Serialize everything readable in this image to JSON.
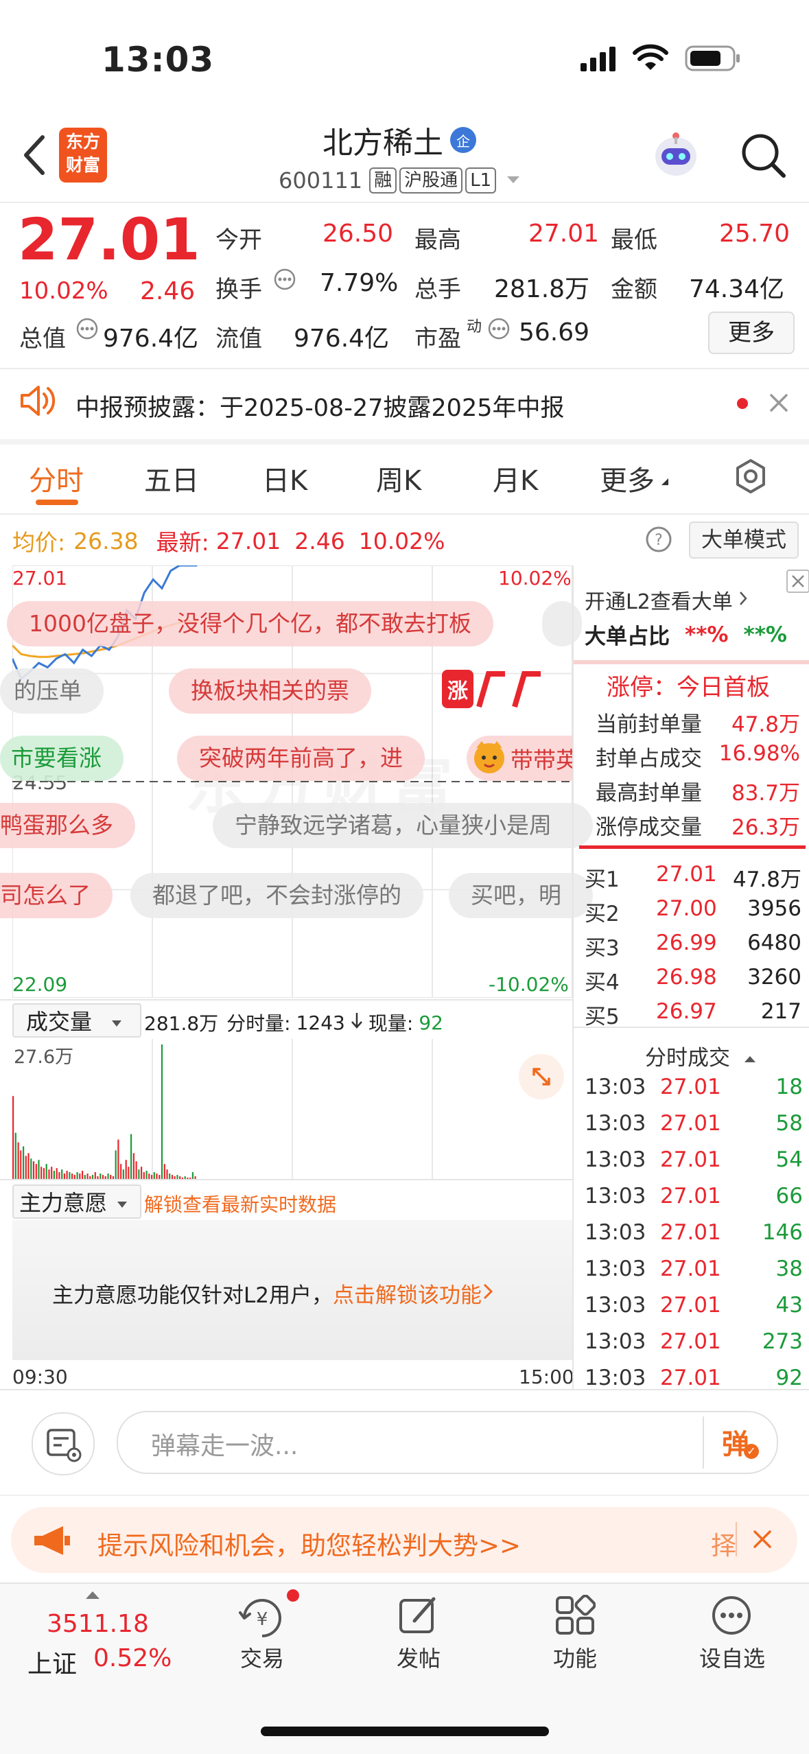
{
  "status_bar": {
    "time": "13:03"
  },
  "header": {
    "logo_line1": "东方",
    "logo_line2": "财富",
    "stock_name": "北方稀土",
    "badge": "企",
    "stock_code": "600111",
    "tags": [
      "融",
      "沪股通",
      "L1"
    ]
  },
  "quote": {
    "price": "27.01",
    "change_pct": "10.02%",
    "change": "2.46",
    "stats": [
      {
        "label": "今开",
        "value": "26.50"
      },
      {
        "label": "最高",
        "value": "27.01"
      },
      {
        "label": "最低",
        "value": "25.70"
      },
      {
        "label": "换手",
        "value": "7.79%"
      },
      {
        "label": "总手",
        "value": "281.8万"
      },
      {
        "label": "金额",
        "value": "74.34亿"
      },
      {
        "label": "总值",
        "value": "976.4亿"
      },
      {
        "label": "流值",
        "value": "976.4亿"
      },
      {
        "label": "市盈",
        "label_sup": "动",
        "value": "56.69"
      }
    ],
    "more_button": "更多"
  },
  "notice": {
    "text": "中报预披露：于2025-08-27披露2025年中报"
  },
  "tabs": [
    "分时",
    "五日",
    "日K",
    "周K",
    "月K",
    "更多"
  ],
  "chart_info": {
    "avg_label": "均价:",
    "avg_value": "26.38",
    "latest_label": "最新:",
    "latest_value": "27.01",
    "latest_change": "2.46",
    "latest_pct": "10.02%",
    "mode_button": "大单模式"
  },
  "chart_data": {
    "type": "line",
    "y_top_label": "27.01",
    "y_bottom_label": "22.09",
    "y_mid_label": "24.55",
    "right_top_label": "10.02%",
    "right_bottom_label": "-10.02%",
    "x_start": "09:30",
    "x_end": "15:00",
    "ylim": [
      22.09,
      27.01
    ],
    "price_series": [
      25.95,
      25.72,
      25.8,
      25.9,
      25.85,
      25.95,
      26.0,
      25.9,
      26.05,
      25.98,
      26.1,
      26.05,
      26.2,
      26.5,
      26.4,
      26.7,
      26.85,
      26.75,
      26.95,
      27.01,
      27.01,
      27.01
    ],
    "avg_series": [
      26.1,
      26.0,
      25.98,
      25.97,
      25.97,
      25.98,
      25.99,
      26.0,
      26.01,
      26.03,
      26.05,
      26.07,
      26.1,
      26.14,
      26.18,
      26.22,
      26.26,
      26.3,
      26.33,
      26.36,
      26.38,
      26.38
    ]
  },
  "volume": {
    "selector": "成交量",
    "total": "281.8万",
    "period_label": "分时量:",
    "period_value": "1243",
    "now_label": "现量:",
    "now_value": "92",
    "max_label": "27.6万",
    "bars": [
      0.62,
      0.35,
      0.28,
      0.22,
      0.25,
      0.18,
      0.2,
      0.16,
      0.14,
      0.12,
      0.15,
      0.1,
      0.09,
      0.12,
      0.08,
      0.1,
      0.07,
      0.09,
      0.06,
      0.08,
      0.05,
      0.07,
      0.06,
      0.05,
      0.04,
      0.06,
      0.05,
      0.07,
      0.04,
      0.05,
      0.03,
      0.04,
      0.06,
      0.03,
      0.05,
      0.04,
      0.03,
      0.05,
      0.04,
      0.03,
      0.22,
      0.3,
      0.12,
      0.08,
      0.15,
      0.1,
      0.34,
      0.2,
      0.14,
      0.08,
      0.1,
      0.06,
      0.07,
      0.05,
      0.04,
      0.06,
      0.05,
      0.04,
      1.0,
      0.12,
      0.08,
      0.05,
      0.04,
      0.03,
      0.04,
      0.03,
      0.02,
      0.03,
      0.02,
      0.02,
      0.06,
      0.03
    ]
  },
  "main_force": {
    "selector": "主力意愿",
    "unlock_link": "解锁查看最新实时数据",
    "message": "主力意愿功能仅针对L2用户，",
    "message_link": "点击解锁该功能"
  },
  "danmaku": [
    {
      "text": "1000亿盘子，没得个几个亿，都不敢去打板",
      "style": "red"
    },
    {
      "text": "的压单",
      "style": "gray"
    },
    {
      "text": "换板块相关的票",
      "style": "red"
    },
    {
      "text": "市要看涨",
      "style": "green"
    },
    {
      "text": "突破两年前高了，进",
      "style": "red"
    },
    {
      "text": "带带英",
      "style": "red"
    },
    {
      "text": "鸭蛋那么多",
      "style": "red"
    },
    {
      "text": "宁静致远学诸葛，心量狭小是周",
      "style": "gray"
    },
    {
      "text": "司怎么了",
      "style": "red"
    },
    {
      "text": "都退了吧，不会封涨停的",
      "style": "gray"
    },
    {
      "text": "买吧，明",
      "style": "gray"
    }
  ],
  "side_panel": {
    "l2_link": "开通L2查看大单",
    "big_order_label": "大单占比",
    "big_order_v1": "**%",
    "big_order_v2": "**%",
    "limit_title": "涨停：今日首板",
    "limit_rows": [
      {
        "label": "当前封单量",
        "value": "47.8万"
      },
      {
        "label": "封单占成交",
        "value": "16.98%"
      },
      {
        "label": "最高封单量",
        "value": "83.7万"
      },
      {
        "label": "涨停成交量",
        "value": "26.3万"
      }
    ],
    "order_book": [
      {
        "label": "买1",
        "price": "27.01",
        "qty": "47.8万"
      },
      {
        "label": "买2",
        "price": "27.00",
        "qty": "3956"
      },
      {
        "label": "买3",
        "price": "26.99",
        "qty": "6480"
      },
      {
        "label": "买4",
        "price": "26.98",
        "qty": "3260"
      },
      {
        "label": "买5",
        "price": "26.97",
        "qty": "217"
      }
    ],
    "trades_title": "分时成交",
    "trades": [
      {
        "time": "13:03",
        "price": "27.01",
        "qty": "18"
      },
      {
        "time": "13:03",
        "price": "27.01",
        "qty": "58"
      },
      {
        "time": "13:03",
        "price": "27.01",
        "qty": "54"
      },
      {
        "time": "13:03",
        "price": "27.01",
        "qty": "66"
      },
      {
        "time": "13:03",
        "price": "27.01",
        "qty": "146"
      },
      {
        "time": "13:03",
        "price": "27.01",
        "qty": "38"
      },
      {
        "time": "13:03",
        "price": "27.01",
        "qty": "43"
      },
      {
        "time": "13:03",
        "price": "27.01",
        "qty": "273"
      },
      {
        "time": "13:03",
        "price": "27.01",
        "qty": "92"
      }
    ]
  },
  "comment": {
    "placeholder": "弹幕走一波...",
    "danmu_button": "弹"
  },
  "promo": {
    "text": "提示风险和机会，助您轻松判大势>>",
    "side_char": "择"
  },
  "bottom_nav": {
    "index_value": "3511.18",
    "index_name": "上证",
    "index_pct": "0.52%",
    "items": [
      "交易",
      "发帖",
      "功能",
      "设自选"
    ]
  },
  "colors": {
    "up": "#e8262e",
    "down": "#1b9b3a",
    "avg": "#e69a1c",
    "price_line": "#3a7bd5",
    "accent": "#f06a1e"
  }
}
